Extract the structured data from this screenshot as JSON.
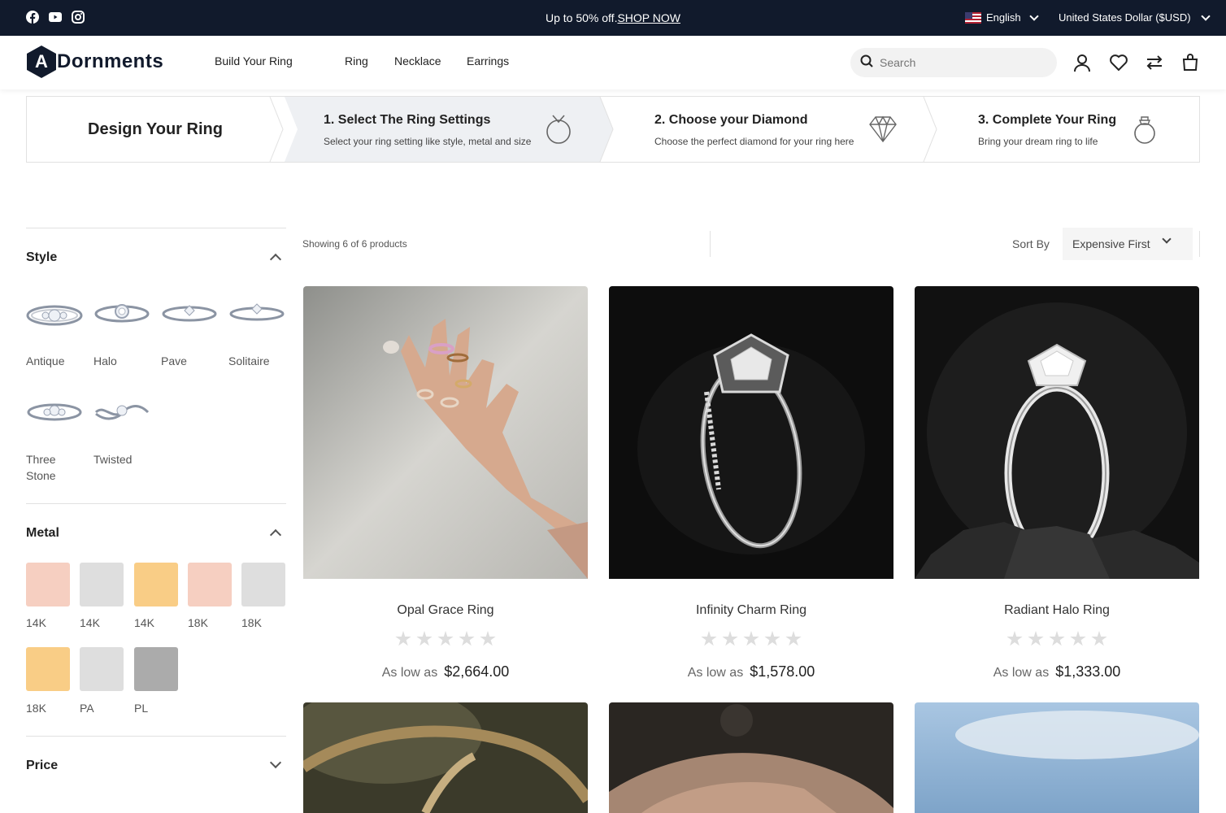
{
  "topbar": {
    "promo_text": "Up to 50% off.",
    "promo_link": "SHOP NOW",
    "language": "English",
    "currency": "United States Dollar ($USD)"
  },
  "header": {
    "logo_text": "Dornments",
    "logo_letter": "A",
    "nav": [
      "Build Your Ring",
      "Ring",
      "Necklace",
      "Earrings"
    ],
    "search_placeholder": "Search"
  },
  "steps": {
    "title": "Design Your Ring",
    "items": [
      {
        "title": "1. Select The Ring Settings",
        "subtitle": "Select your ring setting like style, metal and size",
        "icon": "ring-icon"
      },
      {
        "title": "2. Choose your Diamond",
        "subtitle": "Choose the perfect diamond for your ring here",
        "icon": "diamond-icon"
      },
      {
        "title": "3. Complete Your Ring",
        "subtitle": "Bring your dream ring to life",
        "icon": "ring-complete-icon"
      }
    ]
  },
  "filters": {
    "style": {
      "heading": "Style",
      "items": [
        "Antique",
        "Halo",
        "Pave",
        "Solitaire",
        "Three Stone",
        "Twisted"
      ]
    },
    "metal": {
      "heading": "Metal",
      "items": [
        {
          "label": "14K",
          "color": "#f6cfc1"
        },
        {
          "label": "14K",
          "color": "#dedede"
        },
        {
          "label": "14K",
          "color": "#f9cd86"
        },
        {
          "label": "18K",
          "color": "#f6cfc1"
        },
        {
          "label": "18K",
          "color": "#dedede"
        },
        {
          "label": "18K",
          "color": "#f9cd86"
        },
        {
          "label": "PA",
          "color": "#dedede"
        },
        {
          "label": "PL",
          "color": "#ababab"
        }
      ]
    },
    "price": {
      "heading": "Price"
    }
  },
  "toolbar": {
    "showing": "Showing 6 of 6 products",
    "sort_label": "Sort By",
    "sort_value": "Expensive First"
  },
  "products": [
    {
      "name": "Opal Grace Ring",
      "price_prefix": "As low as",
      "price": "$2,664.00",
      "rating": 0
    },
    {
      "name": "Infinity Charm Ring",
      "price_prefix": "As low as",
      "price": "$1,578.00",
      "rating": 0
    },
    {
      "name": "Radiant Halo Ring",
      "price_prefix": "As low as",
      "price": "$1,333.00",
      "rating": 0
    }
  ]
}
